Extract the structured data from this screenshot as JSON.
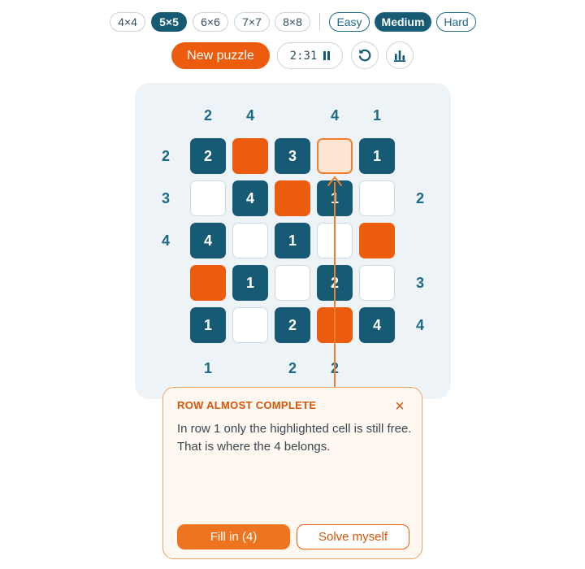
{
  "sizes": [
    {
      "label": "4×4",
      "active": false
    },
    {
      "label": "5×5",
      "active": true
    },
    {
      "label": "6×6",
      "active": false
    },
    {
      "label": "7×7",
      "active": false
    },
    {
      "label": "8×8",
      "active": false
    }
  ],
  "difficulties": [
    {
      "label": "Easy",
      "active": false
    },
    {
      "label": "Medium",
      "active": true
    },
    {
      "label": "Hard",
      "active": false
    }
  ],
  "controls": {
    "new_puzzle_label": "New puzzle",
    "timer": "2:31",
    "pause_icon": "pause-icon",
    "restart_icon": "restart-icon",
    "stats_icon": "bar-chart-icon"
  },
  "colors": {
    "accent": "#ec5c0e",
    "filled": "#175a73",
    "clue": "#1d6a86",
    "highlight": "#fde6d3"
  },
  "board": {
    "clues_top": [
      "2",
      "4",
      "",
      "4",
      "1"
    ],
    "clues_bottom": [
      "1",
      "",
      "2",
      "2",
      ""
    ],
    "clues_left": [
      "2",
      "3",
      "4",
      "",
      ""
    ],
    "clues_right": [
      "",
      "2",
      "",
      "3",
      "4"
    ],
    "grid": [
      [
        {
          "t": "num",
          "v": "2"
        },
        {
          "t": "shade",
          "v": ""
        },
        {
          "t": "num",
          "v": "3"
        },
        {
          "t": "highlight",
          "v": ""
        },
        {
          "t": "num",
          "v": "1"
        }
      ],
      [
        {
          "t": "empty",
          "v": ""
        },
        {
          "t": "num",
          "v": "4"
        },
        {
          "t": "shade",
          "v": ""
        },
        {
          "t": "num",
          "v": "1"
        },
        {
          "t": "empty",
          "v": ""
        }
      ],
      [
        {
          "t": "num",
          "v": "4"
        },
        {
          "t": "empty",
          "v": ""
        },
        {
          "t": "num",
          "v": "1"
        },
        {
          "t": "empty",
          "v": ""
        },
        {
          "t": "shade",
          "v": ""
        }
      ],
      [
        {
          "t": "shade",
          "v": ""
        },
        {
          "t": "num",
          "v": "1"
        },
        {
          "t": "empty",
          "v": ""
        },
        {
          "t": "num",
          "v": "2"
        },
        {
          "t": "empty",
          "v": ""
        }
      ],
      [
        {
          "t": "num",
          "v": "1"
        },
        {
          "t": "empty",
          "v": ""
        },
        {
          "t": "num",
          "v": "2"
        },
        {
          "t": "shade",
          "v": ""
        },
        {
          "t": "num",
          "v": "4"
        }
      ]
    ]
  },
  "hint": {
    "title": "ROW ALMOST COMPLETE",
    "close_icon": "close-icon",
    "text": "In row 1 only the highlighted cell is still free. That is where the 4 belongs.",
    "primary_label": "Fill in (4)",
    "secondary_label": "Solve myself"
  }
}
